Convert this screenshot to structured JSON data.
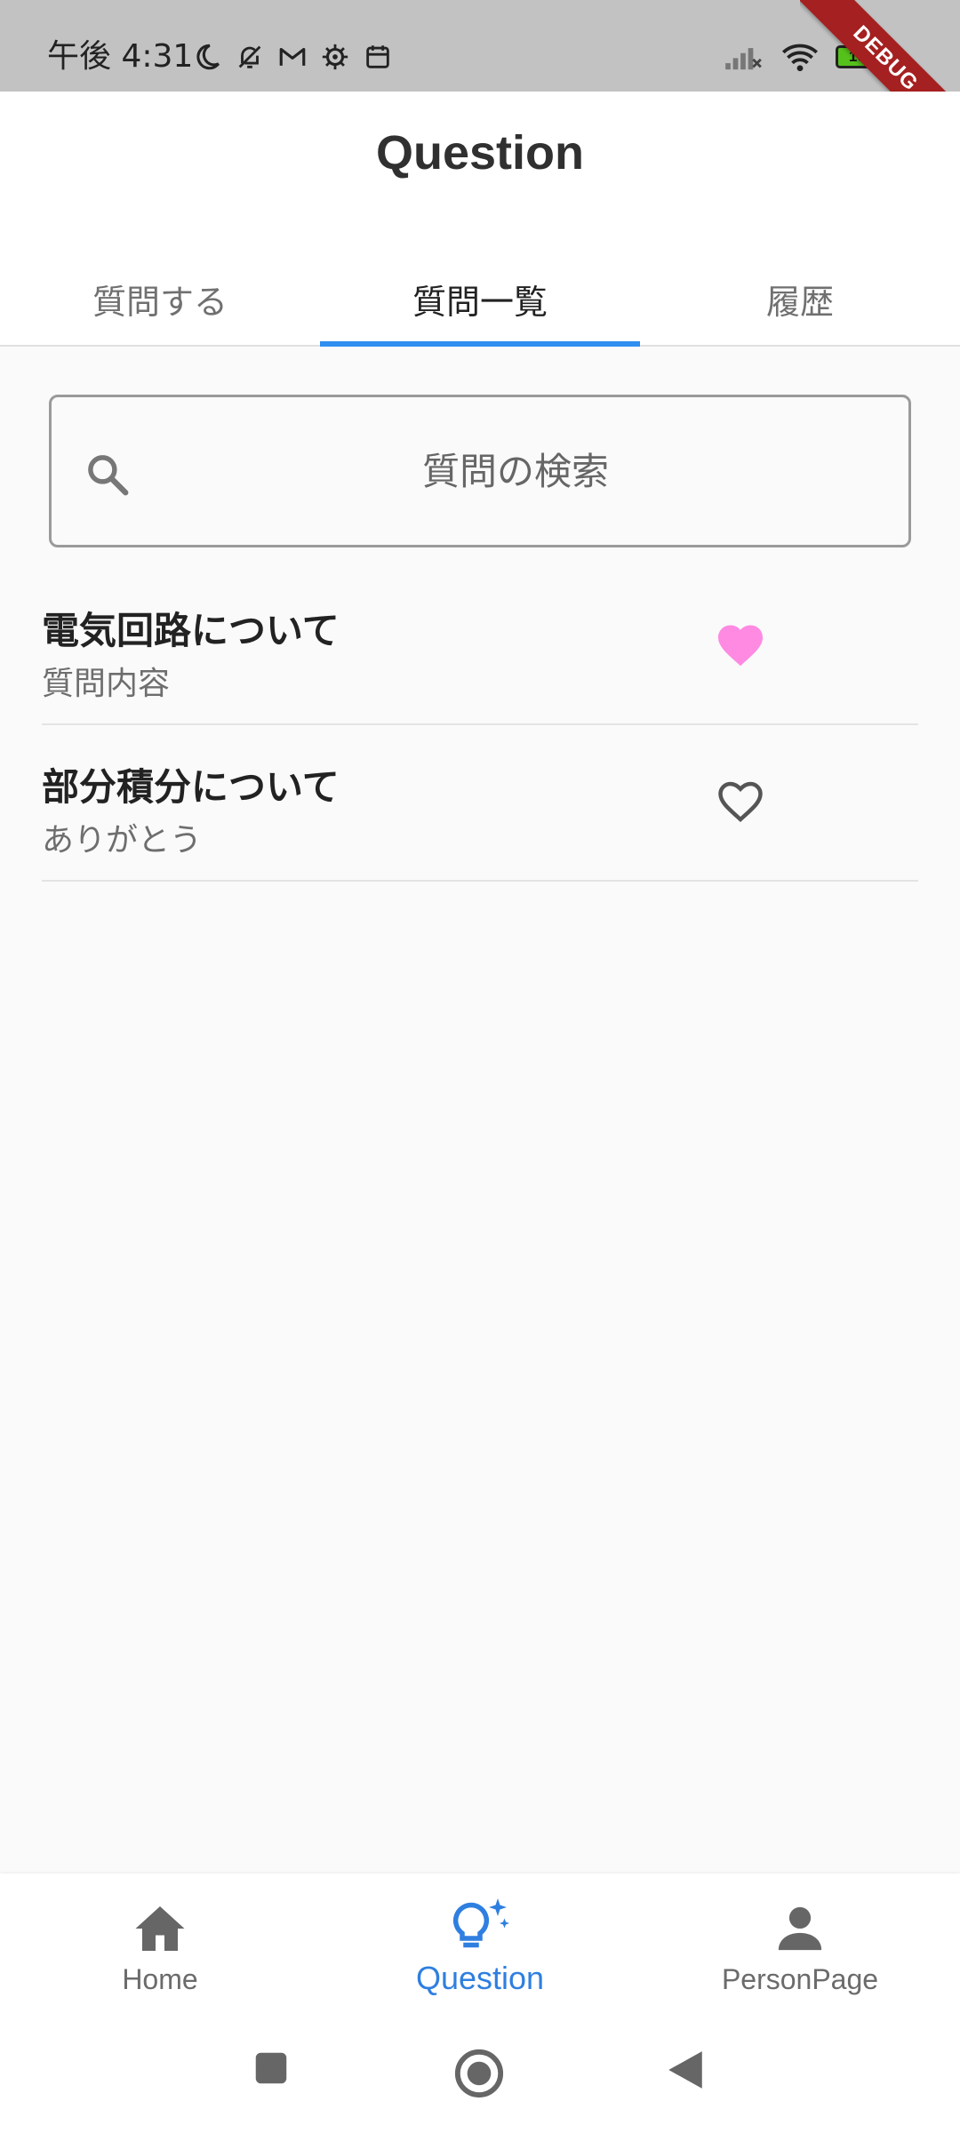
{
  "status_bar": {
    "time": "午後 4:31",
    "left_icons": [
      "moon-icon",
      "bell-off-icon",
      "mail-icon",
      "settings-icon",
      "calendar-icon"
    ],
    "right_icons": [
      "signal-off-icon",
      "wifi-icon",
      "battery-icon"
    ],
    "battery_level": "100"
  },
  "debug_banner": "DEBUG",
  "app_bar": {
    "title": "Question"
  },
  "tabs": [
    {
      "label": "質問する",
      "active": false
    },
    {
      "label": "質問一覧",
      "active": true
    },
    {
      "label": "履歴",
      "active": false
    }
  ],
  "search": {
    "placeholder": "質問の検索",
    "value": ""
  },
  "questions": [
    {
      "title": "電気回路について",
      "subtitle": "質問内容",
      "favorited": true
    },
    {
      "title": "部分積分について",
      "subtitle": "ありがとう",
      "favorited": false
    }
  ],
  "bottom_nav": [
    {
      "label": "Home",
      "icon": "home-icon",
      "active": false
    },
    {
      "label": "Question",
      "icon": "lightbulb-icon",
      "active": true
    },
    {
      "label": "PersonPage",
      "icon": "person-icon",
      "active": false
    }
  ],
  "colors": {
    "accent": "#2f8ef0",
    "nav_active": "#2f7fe0",
    "heart_filled": "#ff8ae2",
    "status_bar": "#c2c2c2",
    "debug_banner": "#a52020"
  }
}
